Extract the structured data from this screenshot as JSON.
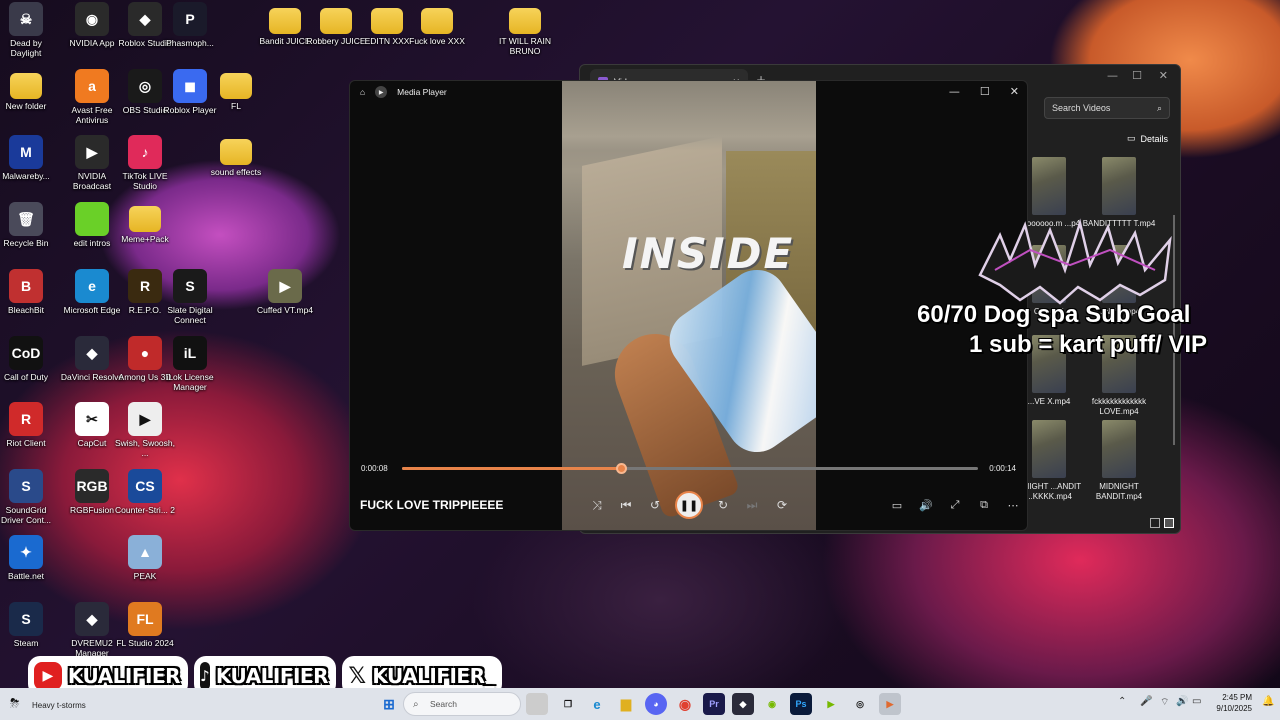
{
  "desktop_icons": [
    {
      "label": "Dead by Daylight",
      "glyph": "☠",
      "color": "#3a3a4a"
    },
    {
      "label": "NVIDIA App",
      "glyph": "◉",
      "color": "#2a2a2a"
    },
    {
      "label": "Roblox Studio",
      "glyph": "◆",
      "color": "#2a2a2a"
    },
    {
      "label": "Phasmoph...",
      "glyph": "P",
      "color": "#1a1a2a"
    },
    {
      "label": "Bandit JUICE",
      "glyph": "",
      "color": "folder"
    },
    {
      "label": "Robbery JUICE",
      "glyph": "",
      "color": "folder"
    },
    {
      "label": "EDITN XXX",
      "glyph": "",
      "color": "folder"
    },
    {
      "label": "Fuck love XXX",
      "glyph": "",
      "color": "folder"
    },
    {
      "label": "IT WILL RAIN BRUNO",
      "glyph": "",
      "color": "folder"
    },
    {
      "label": "New folder",
      "glyph": "",
      "color": "folder"
    },
    {
      "label": "Avast Free Antivirus",
      "glyph": "a",
      "color": "#f07a20"
    },
    {
      "label": "OBS Studio",
      "glyph": "◎",
      "color": "#1a1a1a"
    },
    {
      "label": "Roblox Player",
      "glyph": "◼",
      "color": "#3a6af0"
    },
    {
      "label": "FL",
      "glyph": "",
      "color": "folder"
    },
    {
      "label": "Malwareby...",
      "glyph": "M",
      "color": "#1a3a9a"
    },
    {
      "label": "NVIDIA Broadcast",
      "glyph": "▶",
      "color": "#2a2a2a"
    },
    {
      "label": "TikTok LIVE Studio",
      "glyph": "♪",
      "color": "#e02a5a"
    },
    {
      "label": "sound effects",
      "glyph": "",
      "color": "folder"
    },
    {
      "label": "Recycle Bin",
      "glyph": "🗑",
      "color": "#4a4a5a"
    },
    {
      "label": "edit intros",
      "glyph": "",
      "color": "#6ad028"
    },
    {
      "label": "Meme+Pack",
      "glyph": "",
      "color": "folder"
    },
    {
      "label": "BleachBit",
      "glyph": "B",
      "color": "#c03030"
    },
    {
      "label": "Microsoft Edge",
      "glyph": "e",
      "color": "#1a8ad0"
    },
    {
      "label": "R.E.P.O.",
      "glyph": "R",
      "color": "#3a2a10"
    },
    {
      "label": "Slate Digital Connect",
      "glyph": "S",
      "color": "#1a1a1a"
    },
    {
      "label": "Cuffed VT.mp4",
      "glyph": "▶",
      "color": "#6a6a4a"
    },
    {
      "label": "Call of Duty",
      "glyph": "CoD",
      "color": "#111111"
    },
    {
      "label": "DaVinci Resolve",
      "glyph": "◆",
      "color": "#2a2a3a"
    },
    {
      "label": "Among Us 3D",
      "glyph": "●",
      "color": "#c02a2a"
    },
    {
      "label": "iLok License Manager",
      "glyph": "iL",
      "color": "#111111"
    },
    {
      "label": "Riot Client",
      "glyph": "R",
      "color": "#d02a2a"
    },
    {
      "label": "CapCut",
      "glyph": "✂",
      "color": "#ffffff"
    },
    {
      "label": "Swish, Swoosh, ...",
      "glyph": "▶",
      "color": "#eeeeee"
    },
    {
      "label": "SoundGrid Driver Cont...",
      "glyph": "S",
      "color": "#2a4a8a"
    },
    {
      "label": "RGBFusion",
      "glyph": "RGB",
      "color": "#2a2a2a"
    },
    {
      "label": "Counter-Stri... 2",
      "glyph": "CS",
      "color": "#1a4a9a"
    },
    {
      "label": "Battle.net",
      "glyph": "✦",
      "color": "#1a6ad0"
    },
    {
      "label": "PEAK",
      "glyph": "▲",
      "color": "#8ab0d8"
    },
    {
      "label": "Steam",
      "glyph": "S",
      "color": "#1a2a4a"
    },
    {
      "label": "DVREMU2 Manager",
      "glyph": "◆",
      "color": "#2a2a3a"
    },
    {
      "label": "FL Studio 2024",
      "glyph": "FL",
      "color": "#e07a20"
    }
  ],
  "videos_window": {
    "tab_title": "Videos",
    "search_placeholder": "Search Videos",
    "details_label": "Details",
    "thumbs": [
      {
        "label": "...toooooo.m ...p4"
      },
      {
        "label": "BANDITTTTT T.mp4"
      },
      {
        "label": "C... ...p4"
      },
      {
        "label": "...NE ...mp4"
      },
      {
        "label": "...VE X.mp4"
      },
      {
        "label": "fckkkkkkkkkkkk LOVE.mp4"
      },
      {
        "label": "...NIGHT ...ANDIT ...KKKK.mp4"
      },
      {
        "label": "MIDNIGHT BANDIT.mp4"
      }
    ]
  },
  "media_player": {
    "app_title": "Media Player",
    "video_text": "INSIDE",
    "time_elapsed": "0:00:08",
    "time_total": "0:00:14",
    "progress": 0.38,
    "song_title": "FUCK LOVE TRIPPIEEEE"
  },
  "overlay": {
    "goal_line1": "60/70 Dog spa Sub Goal",
    "goal_line2": "1 sub = kart puff/ VIP"
  },
  "socials": [
    {
      "platform": "youtube",
      "handle": "KUALIFIER"
    },
    {
      "platform": "tiktok",
      "handle": "KUALIFIER"
    },
    {
      "platform": "x",
      "handle": "KUALIFIER_"
    }
  ],
  "taskbar": {
    "weather": "Heavy t-storms",
    "search_placeholder": "Search",
    "time": "2:45 PM",
    "date": "9/10/2025"
  }
}
